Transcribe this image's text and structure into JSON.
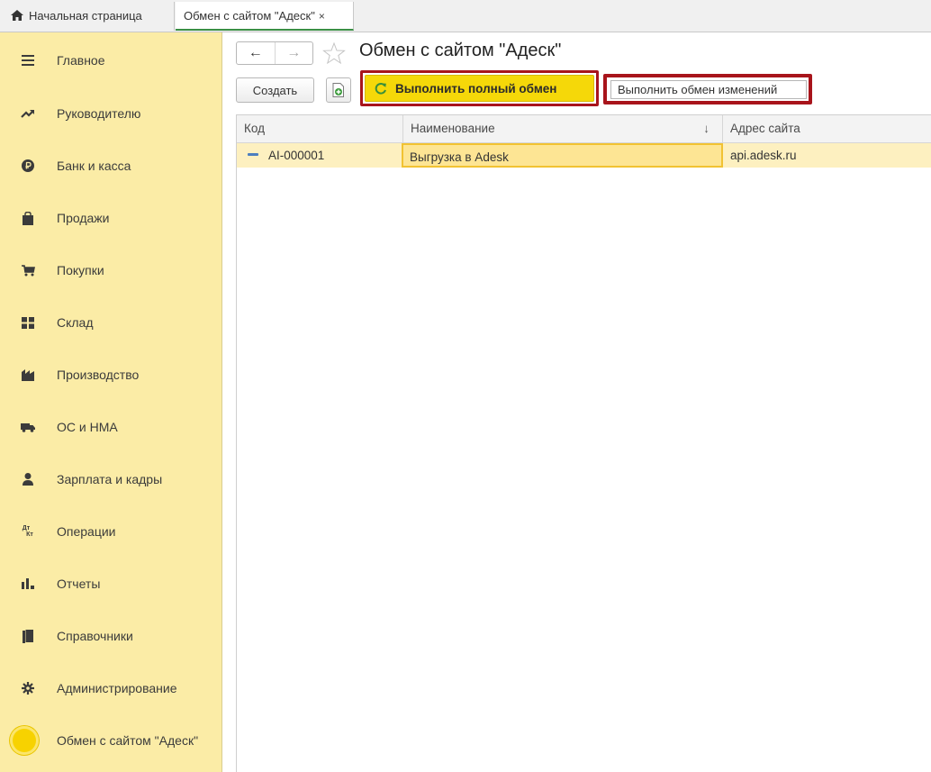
{
  "tabs": {
    "home_label": "Начальная страница",
    "active_label": "Обмен с сайтом \"Адеск\"",
    "close_glyph": "×"
  },
  "sidebar": {
    "items": [
      {
        "label": "Главное",
        "icon": "menu-icon"
      },
      {
        "label": "Руководителю",
        "icon": "trend-icon"
      },
      {
        "label": "Банк и касса",
        "icon": "ruble-icon"
      },
      {
        "label": "Продажи",
        "icon": "bag-icon"
      },
      {
        "label": "Покупки",
        "icon": "cart-icon"
      },
      {
        "label": "Склад",
        "icon": "warehouse-icon"
      },
      {
        "label": "Производство",
        "icon": "factory-icon"
      },
      {
        "label": "ОС и НМА",
        "icon": "truck-icon"
      },
      {
        "label": "Зарплата и кадры",
        "icon": "person-icon"
      },
      {
        "label": "Операции",
        "icon": "dt-kt-icon"
      },
      {
        "label": "Отчеты",
        "icon": "bar-chart-icon"
      },
      {
        "label": "Справочники",
        "icon": "book-icon"
      },
      {
        "label": "Администрирование",
        "icon": "gear-icon"
      },
      {
        "label": "Обмен с сайтом \"Адеск\"",
        "icon": "yellow-circle-icon"
      }
    ],
    "dt_glyph": "Дт",
    "kt_glyph": "Кт"
  },
  "toolbar": {
    "back_glyph": "←",
    "forward_glyph": "→",
    "title": "Обмен с сайтом \"Адеск\"",
    "create_label": "Создать",
    "full_exchange_label": "Выполнить полный обмен",
    "changes_exchange_label": "Выполнить обмен изменений"
  },
  "table": {
    "columns": [
      "Код",
      "Наименование",
      "Адрес сайта"
    ],
    "sort_glyph": "↓",
    "rows": [
      {
        "code": "AI-000001",
        "name": "Выгрузка в Adesk",
        "address": "api.adesk.ru"
      }
    ]
  },
  "colors": {
    "sidebar_bg": "#fbeca6",
    "accent_yellow": "#f5d809",
    "highlight_red": "#a8141b",
    "selected_row": "#fdf0c0"
  }
}
